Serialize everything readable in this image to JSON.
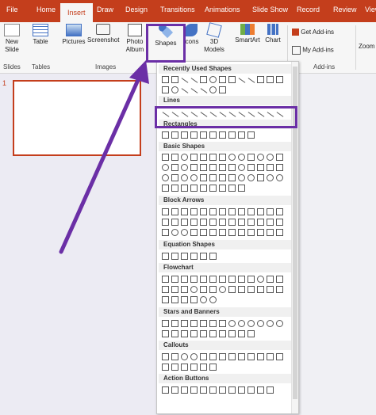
{
  "ribbon_tabs": [
    "File",
    "Home",
    "Insert",
    "Draw",
    "Design",
    "Transitions",
    "Animations",
    "Slide Show",
    "Record",
    "Review",
    "View"
  ],
  "ribbon": {
    "new_slide": "New\nSlide",
    "table": "Table",
    "pictures": "Pictures",
    "screenshot": "Screenshot",
    "photo_album": "Photo\nAlbum",
    "shapes": "Shapes",
    "icons": "Icons",
    "models": "3D\nModels",
    "smartart": "SmartArt",
    "chart": "Chart",
    "get_addins": "Get Add-ins",
    "my_addins": "My Add-ins",
    "zoom": "Zoom",
    "groups": {
      "slides": "Slides",
      "tables": "Tables",
      "images": "Images",
      "addins": "Add-ins"
    }
  },
  "slide_number": "1",
  "shapes_menu": {
    "sections": [
      "Recently Used Shapes",
      "Lines",
      "Rectangles",
      "Basic Shapes",
      "Block Arrows",
      "Equation Shapes",
      "Flowchart",
      "Stars and Banners",
      "Callouts",
      "Action Buttons"
    ]
  },
  "colors": {
    "accent": "#c43e1c",
    "highlight": "#6b2fa6"
  }
}
